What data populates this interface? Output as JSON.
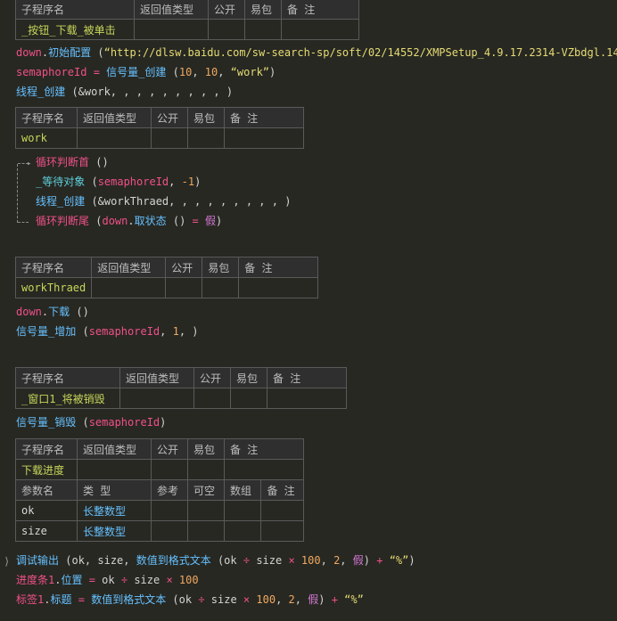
{
  "headers": {
    "sub": "子程序名",
    "ret": "返回值类型",
    "pub": "公开",
    "pkg": "易包",
    "note": "备 注",
    "param": "参数名",
    "type": "类 型",
    "ref": "参考",
    "nullable": "可空",
    "arr": "数组"
  },
  "sub1": {
    "name": "_按钮_下载_被单击"
  },
  "code1": [
    "down.初始配置 (“http://dlsw.baidu.com/sw-search-sp/soft/02/14552/XMPSetup_4.9.17.2314-VZbdgl.14",
    "semaphoreId = 信号量_创建 (10, 10, “work”)",
    "线程_创建 (&work, , , , , , , , , )"
  ],
  "sub2": {
    "name": "work"
  },
  "loop": {
    "head": "循环判断首 ()",
    "wait": "_等待对象 (semaphoreId, -1)",
    "thread": "线程_创建 (&workThraed, , , , , , , , , )",
    "tail": "循环判断尾 (down.取状态 () = 假)"
  },
  "sub3": {
    "name": "workThraed"
  },
  "code3": [
    "down.下载 ()",
    "信号量_增加 (semaphoreId, 1, )"
  ],
  "sub4": {
    "name": "_窗口1_将被销毁"
  },
  "code4": [
    "信号量_销毁 (semaphoreId)"
  ],
  "sub5": {
    "name": "下载进度",
    "params": [
      {
        "name": "ok",
        "type": "长整数型"
      },
      {
        "name": "size",
        "type": "长整数型"
      }
    ]
  },
  "code5": [
    "调试输出 (ok, size, 数值到格式文本 (ok ÷ size × 100, 2, 假) + “%”)",
    "进度条1.位置 = ok ÷ size × 100",
    "标签1.标题 = 数值到格式文本 (ok ÷ size × 100, 2, 假) + “%”"
  ]
}
